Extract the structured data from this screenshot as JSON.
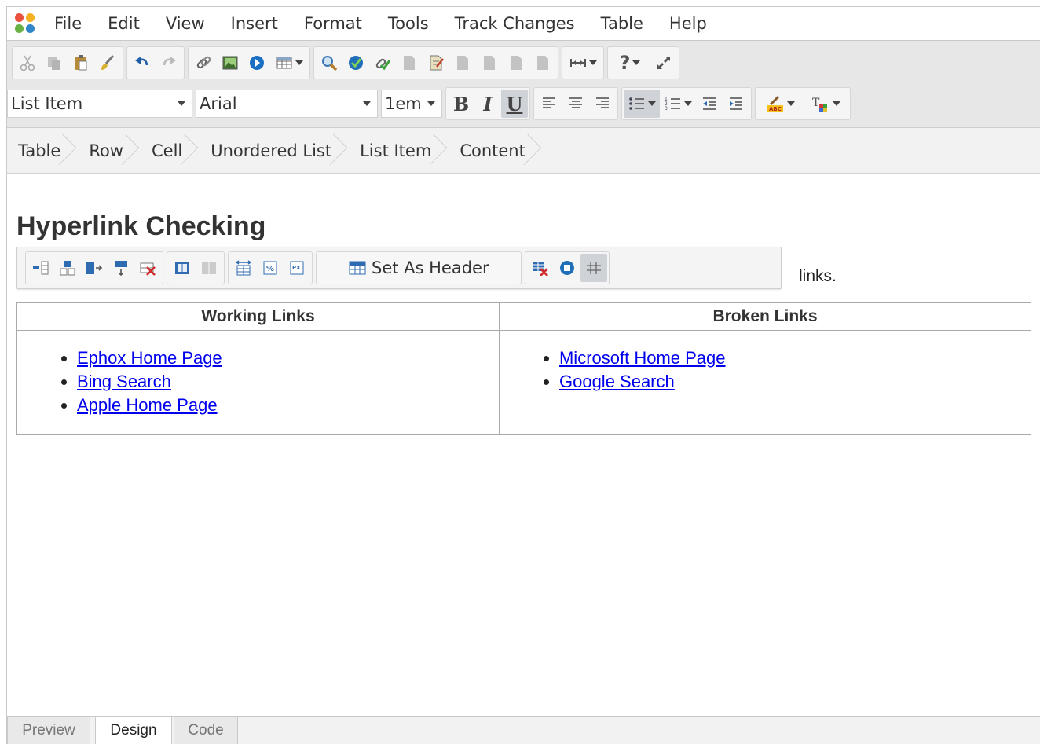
{
  "menu": [
    "File",
    "Edit",
    "View",
    "Insert",
    "Format",
    "Tools",
    "Track Changes",
    "Table",
    "Help"
  ],
  "toolbar": {
    "block_style": "List Item",
    "font_family": "Arial",
    "font_size": "1em",
    "bold": "B",
    "italic": "I",
    "underline": "U",
    "help": "?"
  },
  "breadcrumb": [
    "Table",
    "Row",
    "Cell",
    "Unordered List",
    "List Item",
    "Content"
  ],
  "document": {
    "heading": "Hyperlink Checking",
    "partial_text": "links.",
    "table": {
      "headers": [
        "Working Links",
        "Broken Links"
      ],
      "working_links": [
        "Ephox Home Page",
        "Bing Search",
        "Apple Home Page"
      ],
      "broken_links": [
        "Microsoft Home Page",
        "Google Search"
      ]
    }
  },
  "table_toolbar": {
    "set_header_label": "Set As Header"
  },
  "tabs": [
    "Preview",
    "Design",
    "Code"
  ],
  "active_tab": "Design"
}
